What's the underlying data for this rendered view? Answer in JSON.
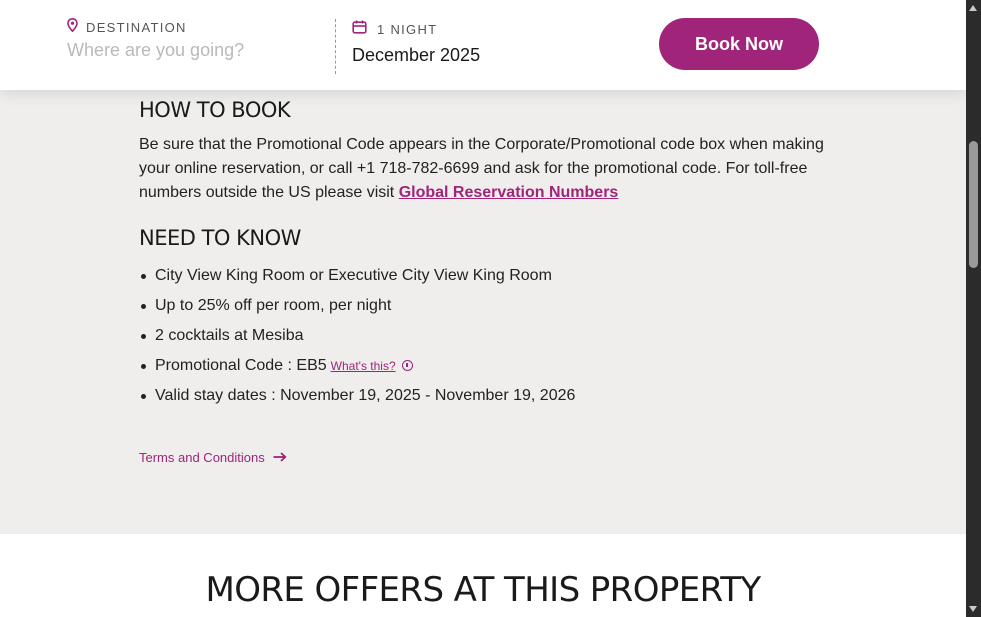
{
  "booking": {
    "destination_label": "DESTINATION",
    "destination_placeholder": "Where are you going?",
    "destination_value": "",
    "nights_label": "1 NIGHT",
    "dates_value": "December 2025",
    "book_button": "Book Now"
  },
  "how_to_book": {
    "title": "HOW TO BOOK",
    "text": "Be sure that the Promotional Code appears in the Corporate/Promotional code box when making your online reservation, or call +1 718-782-6699 and ask for the promotional code. For toll-free numbers outside the US please visit",
    "link": "Global Reservation Numbers"
  },
  "need_to_know": {
    "title": "NEED TO KNOW",
    "items": [
      "City View King Room or Executive City View King Room",
      "Up to 25% off per room, per night",
      "2 cocktails at Mesiba",
      "Promotional Code : EB5",
      "Valid stay dates : November 19, 2025 - November 19, 2026"
    ],
    "whats_this": "What's this?"
  },
  "terms_link": "Terms and Conditions",
  "more_offers_title": "MORE OFFERS AT THIS PROPERTY",
  "colors": {
    "brand": "#a0247a",
    "background": "#efeeed",
    "text": "#222222"
  },
  "icons": {
    "destination": "location-pin-icon",
    "nights": "calendar-icon",
    "terms": "arrow-right-icon",
    "promo": "info-icon"
  }
}
